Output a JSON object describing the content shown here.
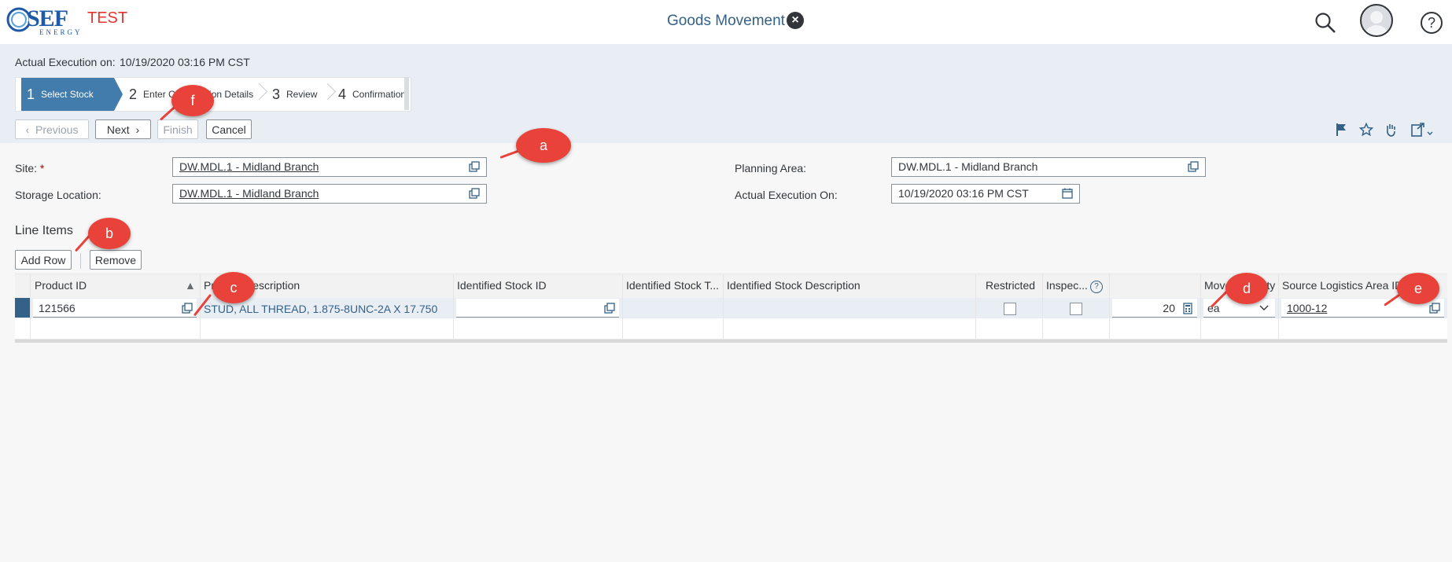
{
  "shell": {
    "logo_text": "SEF",
    "logo_sub": "ENERGY",
    "env_label": "TEST",
    "app_title": "Goods Movement"
  },
  "header": {
    "exec_label": "Actual Execution on:",
    "exec_value": "10/19/2020 03:16 PM CST",
    "steps": [
      {
        "num": "1",
        "label": "Select Stock"
      },
      {
        "num": "2",
        "label": "Enter Confirmation Details"
      },
      {
        "num": "3",
        "label": "Review"
      },
      {
        "num": "4",
        "label": "Confirmation"
      }
    ],
    "buttons": {
      "previous": "Previous",
      "next": "Next",
      "finish": "Finish",
      "cancel": "Cancel"
    }
  },
  "form": {
    "site_label": "Site:",
    "site_required": "*",
    "site_value": "DW.MDL.1 - Midland Branch",
    "storage_label": "Storage Location:",
    "storage_value": "DW.MDL.1 - Midland Branch",
    "planning_label": "Planning Area:",
    "planning_value": "DW.MDL.1 - Midland Branch",
    "exec_on_label": "Actual Execution On:",
    "exec_on_value": "10/19/2020 03:16 PM CST"
  },
  "line_items": {
    "title": "Line Items",
    "add_row": "Add Row",
    "remove": "Remove",
    "columns": {
      "product_id": "Product ID",
      "product_desc": "Product Description",
      "stock_id": "Identified Stock ID",
      "stock_type": "Identified Stock T...",
      "stock_desc": "Identified Stock Description",
      "restricted": "Restricted",
      "inspection": "Inspec...",
      "move_qty": "Move Quantity",
      "source_area": "Source Logistics Area ID"
    },
    "rows": [
      {
        "product_id": "121566",
        "product_desc": "STUD, ALL THREAD, 1.875-8UNC-2A X 17.750",
        "stock_id": "",
        "quantity": "20",
        "unit": "ea",
        "source_area": "1000-12"
      }
    ]
  },
  "callouts": [
    "a",
    "b",
    "c",
    "d",
    "e",
    "f"
  ],
  "colors": {
    "accent": "#427cac",
    "callout": "#e8423a",
    "env": "#e5342f",
    "title": "#346187"
  }
}
